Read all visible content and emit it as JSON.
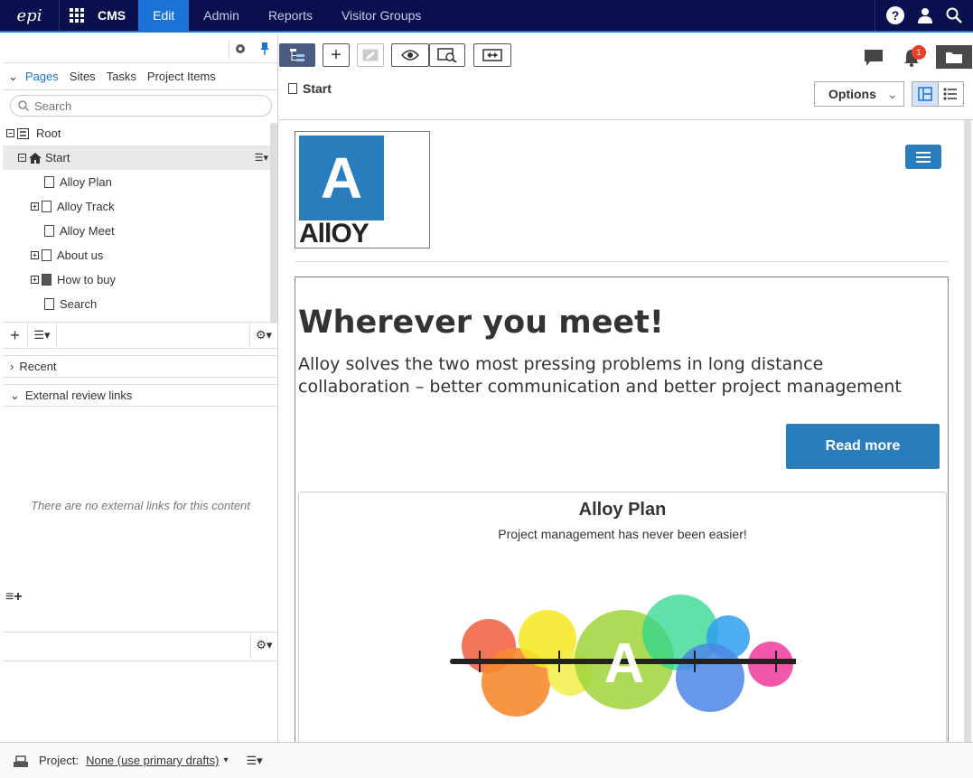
{
  "topbar": {
    "logo": "epi",
    "product": "CMS",
    "nav": [
      "Edit",
      "Admin",
      "Reports",
      "Visitor Groups"
    ]
  },
  "left_panel": {
    "tabs": [
      "Pages",
      "Sites",
      "Tasks",
      "Project Items"
    ],
    "search_placeholder": "Search",
    "tree": [
      {
        "label": "Root",
        "expander": "minus",
        "icon": "root"
      },
      {
        "label": "Start",
        "expander": "minus",
        "icon": "home",
        "selected": true
      },
      {
        "label": "Alloy Plan",
        "expander": "",
        "icon": "page"
      },
      {
        "label": "Alloy Track",
        "expander": "plus",
        "icon": "page"
      },
      {
        "label": "Alloy Meet",
        "expander": "",
        "icon": "page"
      },
      {
        "label": "About us",
        "expander": "plus",
        "icon": "page"
      },
      {
        "label": "How to buy",
        "expander": "plus",
        "icon": "container"
      },
      {
        "label": "Search",
        "expander": "",
        "icon": "page"
      }
    ],
    "recent_label": "Recent",
    "external_links_label": "External review links",
    "external_links_empty": "There are no external links for this content"
  },
  "editor": {
    "page_title": "Start",
    "options_label": "Options",
    "notification_count": "1"
  },
  "preview": {
    "logo_letter": "A",
    "logo_word": "AllOY",
    "headline": "Wherever you meet!",
    "lead": "Alloy solves the two most pressing problems in long distance collaboration – better communication and better project management",
    "cta": "Read more",
    "teaser_title": "Alloy Plan",
    "teaser_subtitle": "Project management has never been easier!",
    "teaser_letter": "A"
  },
  "bottombar": {
    "project_label": "Project:",
    "project_value": "None (use primary drafts)"
  },
  "colors": {
    "topbar": "#0a0f4d",
    "accent": "#1a73d9",
    "alloy_blue": "#2a7dbd"
  }
}
